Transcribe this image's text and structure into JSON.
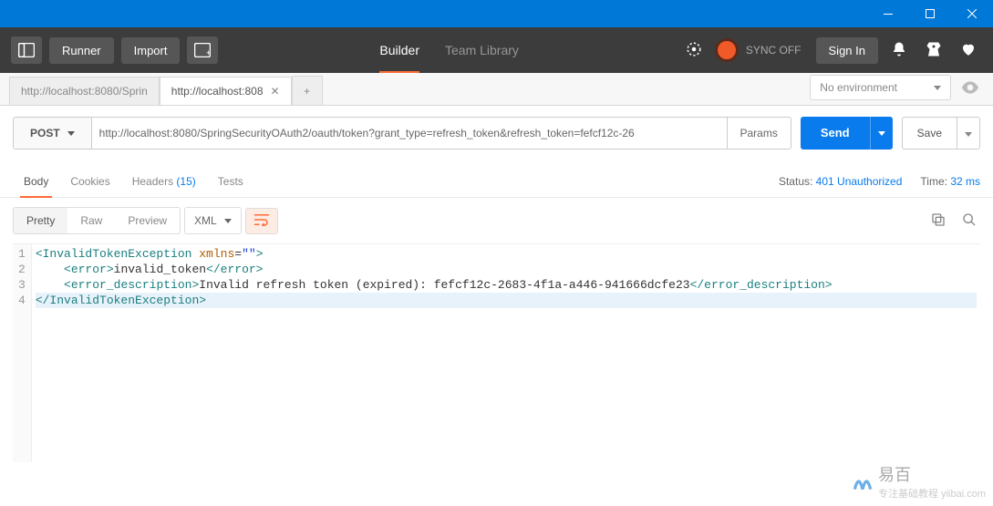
{
  "window": {
    "minimize": "–",
    "maximize": "□",
    "close": "✕"
  },
  "header": {
    "runner": "Runner",
    "import": "Import",
    "builder": "Builder",
    "team_library": "Team Library",
    "sync": "SYNC OFF",
    "signin": "Sign In"
  },
  "env": {
    "no_environment": "No environment"
  },
  "tabs": {
    "inactive": "http://localhost:8080/Sprin",
    "active": "http://localhost:808",
    "add": "+"
  },
  "request": {
    "method": "POST",
    "url": "http://localhost:8080/SpringSecurityOAuth2/oauth/token?grant_type=refresh_token&refresh_token=fefcf12c-26",
    "params": "Params",
    "send": "Send",
    "save": "Save"
  },
  "response_tabs": {
    "body": "Body",
    "cookies": "Cookies",
    "headers": "Headers",
    "headers_count": "(15)",
    "tests": "Tests",
    "status_label": "Status:",
    "status_value": "401 Unauthorized",
    "time_label": "Time:",
    "time_value": "32 ms"
  },
  "view": {
    "pretty": "Pretty",
    "raw": "Raw",
    "preview": "Preview",
    "format": "XML"
  },
  "code": {
    "l1_open": "<InvalidTokenException",
    "l1_attr": " xmlns",
    "l1_eq": "=",
    "l1_val": "\"\"",
    "l1_close": ">",
    "l2_open": "<error>",
    "l2_text": "invalid_token",
    "l2_close": "</error>",
    "l3_open": "<error_description>",
    "l3_text": "Invalid refresh token (expired): fefcf12c-2683-4f1a-a446-941666dcfe23",
    "l3_close": "</error_description>",
    "l4": "</InvalidTokenException>"
  },
  "gutter": {
    "n1": "1",
    "n2": "2",
    "n3": "3",
    "n4": "4"
  },
  "watermark": {
    "main": "易百",
    "sub": "专注基础教程  yiibai.com"
  }
}
